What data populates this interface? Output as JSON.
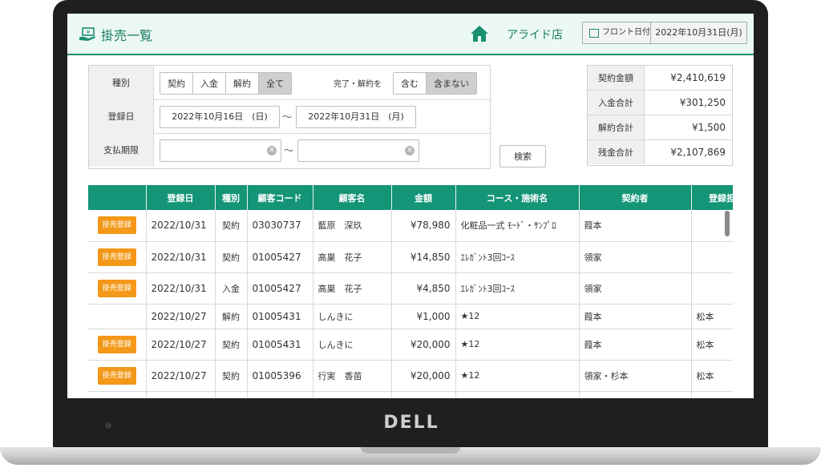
{
  "brand": {
    "logo": "DELL"
  },
  "header": {
    "title": "掛売一覧",
    "store": "アライド店",
    "front_date_label": "フロント日付",
    "front_date": "2022年10月31日(月)"
  },
  "filter": {
    "type_label": "種別",
    "type_options": [
      "契約",
      "入金",
      "解約",
      "全て"
    ],
    "type_selected": "全て",
    "complete_label": "完了・解約を",
    "complete_options": [
      "含む",
      "含まない"
    ],
    "complete_selected": "含まない",
    "reg_label": "登録日",
    "reg_from": "2022年10月16日　(日)",
    "reg_to": "2022年10月31日　(月)",
    "due_label": "支払期限",
    "due_from": "",
    "due_to": "",
    "tilde": "～",
    "search_button": "検索"
  },
  "summary": {
    "rows": [
      {
        "label": "契約金額",
        "value": "¥2,410,619"
      },
      {
        "label": "入金合計",
        "value": "¥301,250"
      },
      {
        "label": "解約合計",
        "value": "¥1,500"
      },
      {
        "label": "残金合計",
        "value": "¥2,107,869"
      }
    ]
  },
  "table": {
    "headers": [
      "",
      "登録日",
      "種別",
      "顧客コード",
      "顧客名",
      "金額",
      "コース・施術名",
      "契約者",
      "登録担当"
    ],
    "badge_label": "掛売登録",
    "rows": [
      {
        "badge": true,
        "date": "2022/10/31",
        "type": "契約",
        "code": "03030737",
        "name": "藍原　深玖",
        "amount": "¥78,980",
        "course": "化粧品一式 ﾓｰﾄﾞ・ｻﾝﾌﾟﾛ",
        "contractor": "葭本",
        "staff": ""
      },
      {
        "badge": true,
        "date": "2022/10/31",
        "type": "契約",
        "code": "01005427",
        "name": "高巣　花子",
        "amount": "¥14,850",
        "course": "ｴﾚｶﾞﾝﾄ3回ｺｰｽ",
        "contractor": "領家",
        "staff": ""
      },
      {
        "badge": true,
        "date": "2022/10/31",
        "type": "入金",
        "code": "01005427",
        "name": "高巣　花子",
        "amount": "¥4,850",
        "course": "ｴﾚｶﾞﾝﾄ3回ｺｰｽ",
        "contractor": "領家",
        "staff": ""
      },
      {
        "badge": false,
        "date": "2022/10/27",
        "type": "解約",
        "code": "01005431",
        "name": "しんきに",
        "amount": "¥1,000",
        "course": "★12",
        "contractor": "葭本",
        "staff": "松本"
      },
      {
        "badge": true,
        "date": "2022/10/27",
        "type": "契約",
        "code": "01005431",
        "name": "しんきに",
        "amount": "¥20,000",
        "course": "★12",
        "contractor": "葭本",
        "staff": "松本"
      },
      {
        "badge": true,
        "date": "2022/10/27",
        "type": "契約",
        "code": "01005396",
        "name": "行実　香苗",
        "amount": "¥20,000",
        "course": "★12",
        "contractor": "領家・杉本",
        "staff": "松本"
      },
      {
        "badge": false,
        "date": "",
        "type": "",
        "code": "",
        "name": "",
        "amount": "",
        "course": "",
        "contractor": "",
        "staff": ""
      }
    ]
  },
  "colors": {
    "accent": "#149578",
    "badge": "#f39819",
    "header_bg": "#ecf8f4"
  }
}
